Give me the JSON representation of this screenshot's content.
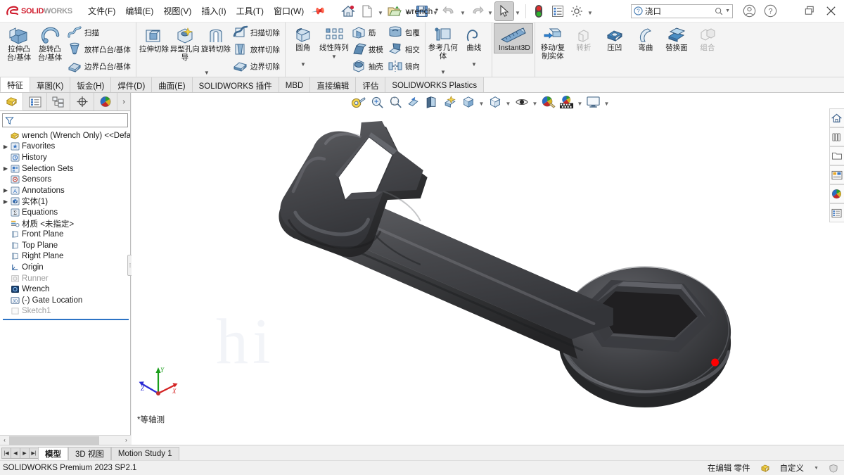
{
  "app": {
    "brand_ds": "3DS",
    "brand_solid": "SOLID",
    "brand_works": "WORKS",
    "document_title": "wrench *",
    "status_version": "SOLIDWORKS Premium 2023 SP2.1",
    "status_mode": "在编辑 零件",
    "status_custom": "自定义",
    "accent_color": "#cf1a2b",
    "selected_color": "#cfcfcf"
  },
  "menu": {
    "items": [
      {
        "label": "文件(F)"
      },
      {
        "label": "编辑(E)"
      },
      {
        "label": "视图(V)"
      },
      {
        "label": "插入(I)"
      },
      {
        "label": "工具(T)"
      },
      {
        "label": "窗口(W)"
      }
    ],
    "pin_icon": "pushpin-icon"
  },
  "quick_access": [
    {
      "name": "home-icon",
      "caret": false,
      "selected": false
    },
    {
      "name": "new-document-icon",
      "caret": true,
      "selected": false
    },
    {
      "name": "open-folder-icon",
      "caret": true,
      "selected": false
    },
    {
      "name": "save-icon",
      "caret": true,
      "selected": false
    },
    {
      "name": "undo-icon",
      "caret": true,
      "selected": false,
      "disabled": true
    },
    {
      "name": "redo-icon",
      "caret": true,
      "selected": false,
      "disabled": true
    },
    {
      "name": "select-cursor-icon",
      "caret": true,
      "selected": true
    },
    {
      "name": "rebuild-traffic-light-icon",
      "caret": false,
      "selected": false
    },
    {
      "name": "options-list-icon",
      "caret": false,
      "selected": false
    },
    {
      "name": "settings-gear-icon",
      "caret": true,
      "selected": false
    }
  ],
  "search": {
    "placeholder": "",
    "value": "浇口",
    "help_icon": "question-circle-icon",
    "search_icon": "magnifier-icon"
  },
  "title_right": [
    {
      "name": "user-account-icon"
    },
    {
      "name": "help-circle-icon"
    },
    {
      "name": "restore-window-icon"
    },
    {
      "name": "close-window-icon"
    }
  ],
  "ribbon": {
    "collapse_icon": "chevron-up-icon",
    "groups": [
      {
        "name": "features-boss",
        "big": [
          {
            "label": "拉伸凸台/基体",
            "icon": "extrude-boss-icon"
          },
          {
            "label": "旋转凸台/基体",
            "icon": "revolve-boss-icon"
          }
        ],
        "small": [
          {
            "label": "扫描",
            "icon": "sweep-icon"
          },
          {
            "label": "放样凸台/基体",
            "icon": "loft-boss-icon"
          },
          {
            "label": "边界凸台/基体",
            "icon": "boundary-boss-icon"
          }
        ]
      },
      {
        "name": "features-cut",
        "big": [
          {
            "label": "拉伸切除",
            "icon": "extrude-cut-icon"
          },
          {
            "label": "异型孔向导",
            "icon": "hole-wizard-icon"
          },
          {
            "label": "旋转切除",
            "icon": "revolve-cut-icon"
          }
        ],
        "small": [
          {
            "label": "扫描切除",
            "icon": "sweep-cut-icon"
          },
          {
            "label": "放样切除",
            "icon": "loft-cut-icon"
          },
          {
            "label": "边界切除",
            "icon": "boundary-cut-icon"
          }
        ],
        "caret": true
      },
      {
        "name": "features-modify",
        "big": [
          {
            "label": "圆角",
            "icon": "fillet-icon",
            "caret": true
          },
          {
            "label": "线性阵列",
            "icon": "linear-pattern-icon",
            "caret": true
          }
        ],
        "small": [
          {
            "label": "筋",
            "icon": "rib-icon"
          },
          {
            "label": "拔模",
            "icon": "draft-icon"
          },
          {
            "label": "抽壳",
            "icon": "shell-icon"
          }
        ],
        "small2": [
          {
            "label": "包覆",
            "icon": "wrap-icon"
          },
          {
            "label": "相交",
            "icon": "intersect-icon"
          },
          {
            "label": "镜向",
            "icon": "mirror-icon"
          }
        ]
      },
      {
        "name": "features-reference",
        "big": [
          {
            "label": "参考几何体",
            "icon": "reference-geometry-icon",
            "caret": true
          },
          {
            "label": "曲线",
            "icon": "curves-icon",
            "caret": true
          }
        ]
      },
      {
        "name": "features-instant3d",
        "big": [
          {
            "label": "Instant3D",
            "icon": "instant3d-icon",
            "selected": true
          }
        ]
      },
      {
        "name": "features-direct-edit",
        "big": [
          {
            "label": "移动/复制实体",
            "icon": "move-copy-body-icon"
          },
          {
            "label": "转折",
            "icon": "jog-icon",
            "disabled": true
          },
          {
            "label": "压凹",
            "icon": "indent-icon"
          },
          {
            "label": "弯曲",
            "icon": "flex-icon"
          },
          {
            "label": "替换面",
            "icon": "replace-face-icon"
          },
          {
            "label": "组合",
            "icon": "combine-icon",
            "disabled": true
          }
        ]
      }
    ]
  },
  "command_tabs": [
    {
      "label": "特征",
      "active": true
    },
    {
      "label": "草图(K)",
      "active": false
    },
    {
      "label": "钣金(H)",
      "active": false
    },
    {
      "label": "焊件(D)",
      "active": false
    },
    {
      "label": "曲面(E)",
      "active": false
    },
    {
      "label": "SOLIDWORKS 插件",
      "active": false
    },
    {
      "label": "MBD",
      "active": false
    },
    {
      "label": "直接编辑",
      "active": false
    },
    {
      "label": "评估",
      "active": false
    },
    {
      "label": "SOLIDWORKS Plastics",
      "active": false
    }
  ],
  "feature_manager": {
    "tabs": [
      {
        "name": "feature-tree-tab",
        "icon": "feature-tree-icon",
        "active": true
      },
      {
        "name": "property-manager-tab",
        "icon": "property-manager-icon",
        "active": false
      },
      {
        "name": "configuration-manager-tab",
        "icon": "configuration-manager-icon",
        "active": false
      },
      {
        "name": "dimxpert-manager-tab",
        "icon": "dimxpert-icon",
        "active": false
      },
      {
        "name": "display-manager-tab",
        "icon": "display-manager-icon",
        "active": false
      }
    ],
    "more_icon": "chevron-right-icon",
    "filter_icon": "filter-funnel-icon",
    "filter_placeholder": "",
    "root": {
      "label": "wrench (Wrench Only) <<Default>_D",
      "icon": "part-document-icon"
    },
    "nodes": [
      {
        "label": "Favorites",
        "icon": "favorites-icon",
        "expandable": true,
        "dim": false
      },
      {
        "label": "History",
        "icon": "history-icon",
        "expandable": false,
        "dim": false
      },
      {
        "label": "Selection Sets",
        "icon": "selection-sets-icon",
        "expandable": true,
        "dim": false
      },
      {
        "label": "Sensors",
        "icon": "sensors-icon",
        "expandable": false,
        "dim": false
      },
      {
        "label": "Annotations",
        "icon": "annotations-icon",
        "expandable": true,
        "dim": false
      },
      {
        "label": "实体(1)",
        "icon": "solid-bodies-icon",
        "expandable": true,
        "dim": false
      },
      {
        "label": "Equations",
        "icon": "equations-icon",
        "expandable": false,
        "dim": false
      },
      {
        "label": "材质 <未指定>",
        "icon": "material-icon",
        "expandable": false,
        "dim": false
      },
      {
        "label": "Front Plane",
        "icon": "plane-icon",
        "expandable": false,
        "dim": false
      },
      {
        "label": "Top Plane",
        "icon": "plane-icon",
        "expandable": false,
        "dim": false
      },
      {
        "label": "Right Plane",
        "icon": "plane-icon",
        "expandable": false,
        "dim": false
      },
      {
        "label": "Origin",
        "icon": "origin-icon",
        "expandable": false,
        "dim": false
      },
      {
        "label": "Runner",
        "icon": "runner-icon",
        "expandable": false,
        "dim": true
      },
      {
        "label": "Wrench",
        "icon": "wrench-body-icon",
        "expandable": false,
        "dim": false
      },
      {
        "label": "(-) Gate Location",
        "icon": "gate-location-3d-icon",
        "expandable": false,
        "dim": false
      },
      {
        "label": "Sketch1",
        "icon": "sketch-icon",
        "expandable": false,
        "dim": true
      }
    ],
    "hscroll": {
      "left_arrow": "‹",
      "right_arrow": "›"
    }
  },
  "view_toolbar": [
    {
      "name": "measure-icon",
      "caret": false
    },
    {
      "name": "zoom-to-fit-icon",
      "caret": false
    },
    {
      "name": "zoom-area-icon",
      "caret": false
    },
    {
      "name": "previous-view-icon",
      "caret": false
    },
    {
      "name": "section-view-icon",
      "caret": false
    },
    {
      "name": "view-orientation-magic-icon",
      "caret": false
    },
    {
      "name": "view-orientation-icon",
      "caret": true
    },
    {
      "name": "display-style-icon",
      "caret": true
    },
    {
      "name": "hide-show-items-icon",
      "caret": true
    },
    {
      "name": "edit-appearance-icon",
      "caret": false
    },
    {
      "name": "apply-scene-icon",
      "caret": true
    },
    {
      "name": "view-settings-icon",
      "caret": true
    }
  ],
  "viewport": {
    "view_label": "*等轴测",
    "watermark": "hi",
    "triad": {
      "x_label": "X",
      "x_color": "#d42222",
      "y_label": "Y",
      "y_color": "#1a9e1a",
      "z_label": "Z",
      "z_color": "#2a2ad4"
    },
    "model": {
      "name": "wrench-3d-model",
      "body_color": "#3c3c3e",
      "highlight_color": "#6e6e72",
      "shadow_color": "#232325",
      "gate_point_color": "#ff0000"
    }
  },
  "right_toolbar": [
    {
      "name": "task-pane-home-icon"
    },
    {
      "name": "design-library-icon"
    },
    {
      "name": "file-explorer-icon"
    },
    {
      "name": "view-palette-icon"
    },
    {
      "name": "appearances-scenes-icon"
    },
    {
      "name": "custom-properties-icon"
    }
  ],
  "bottom_tabs": [
    {
      "label": "模型",
      "active": true
    },
    {
      "label": "3D 视图",
      "active": false
    },
    {
      "label": "Motion Study 1",
      "active": false
    }
  ],
  "nav_buttons": [
    "|◀",
    "◀",
    "▶",
    "▶|"
  ]
}
